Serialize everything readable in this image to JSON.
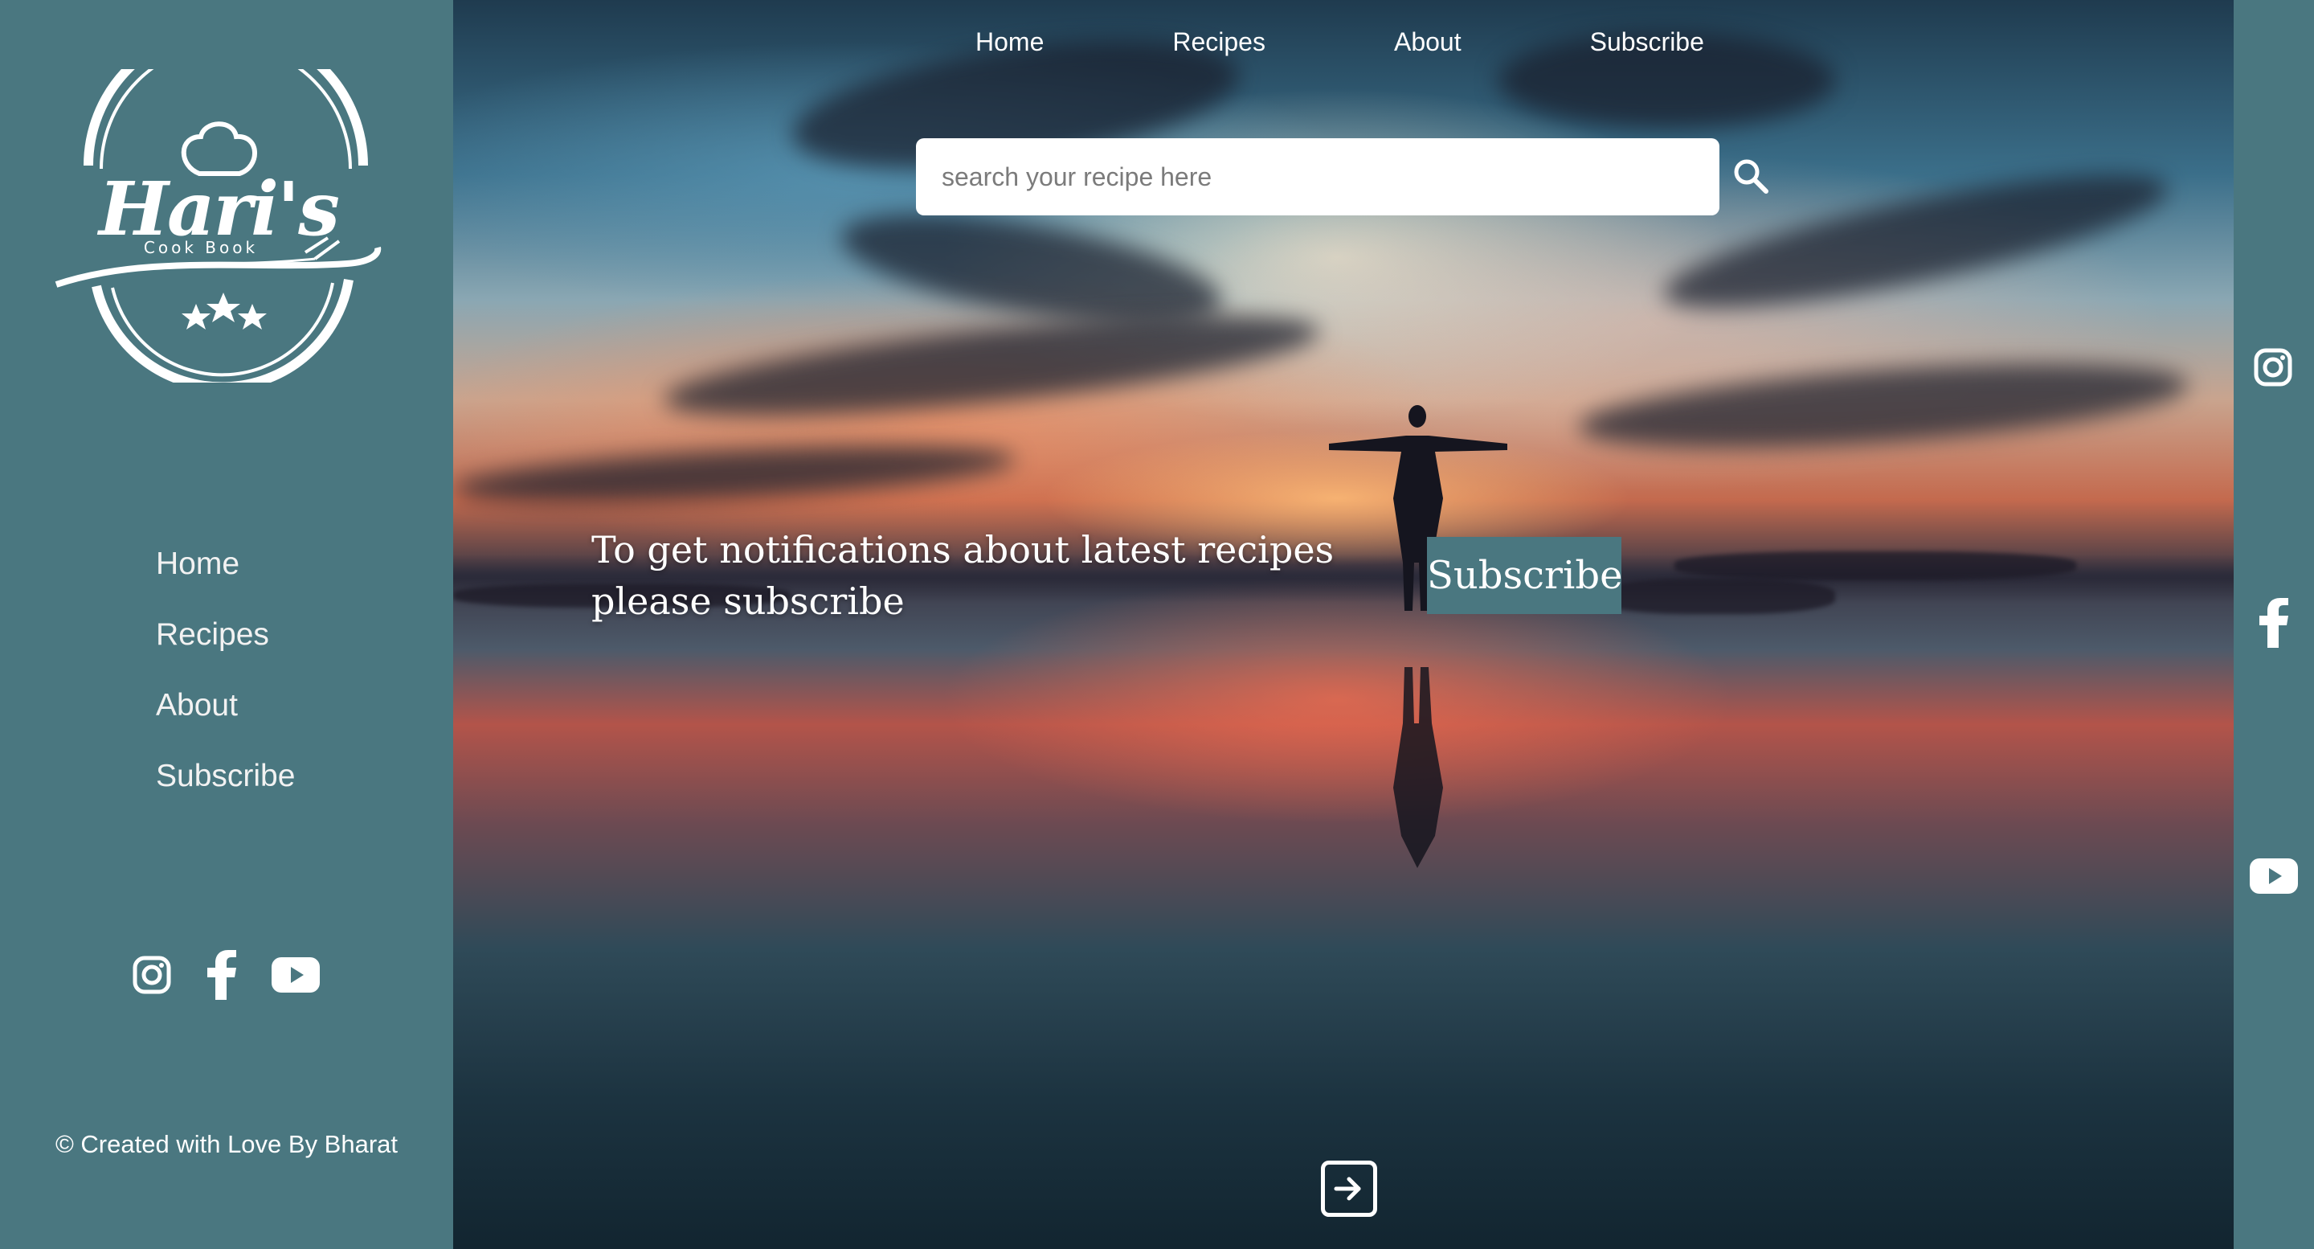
{
  "brand": {
    "name": "Hari's",
    "tagline": "Cook Book"
  },
  "sidebar": {
    "nav": [
      {
        "label": "Home"
      },
      {
        "label": "Recipes"
      },
      {
        "label": "About"
      },
      {
        "label": "Subscribe"
      }
    ],
    "social_icons": [
      "instagram-icon",
      "facebook-icon",
      "youtube-icon"
    ],
    "credit": "© Created with Love By Bharat"
  },
  "top_nav": [
    {
      "label": "Home"
    },
    {
      "label": "Recipes"
    },
    {
      "label": "About"
    },
    {
      "label": "Subscribe"
    }
  ],
  "search": {
    "placeholder": "search your recipe here",
    "value": ""
  },
  "hero": {
    "notify_text": "To get notifications about latest recipes please subscribe",
    "subscribe_label": "Subscribe"
  },
  "right_social_icons": [
    "instagram-icon",
    "facebook-icon",
    "youtube-icon"
  ],
  "colors": {
    "sidebar": "#4a7780",
    "text": "#ffffff"
  }
}
